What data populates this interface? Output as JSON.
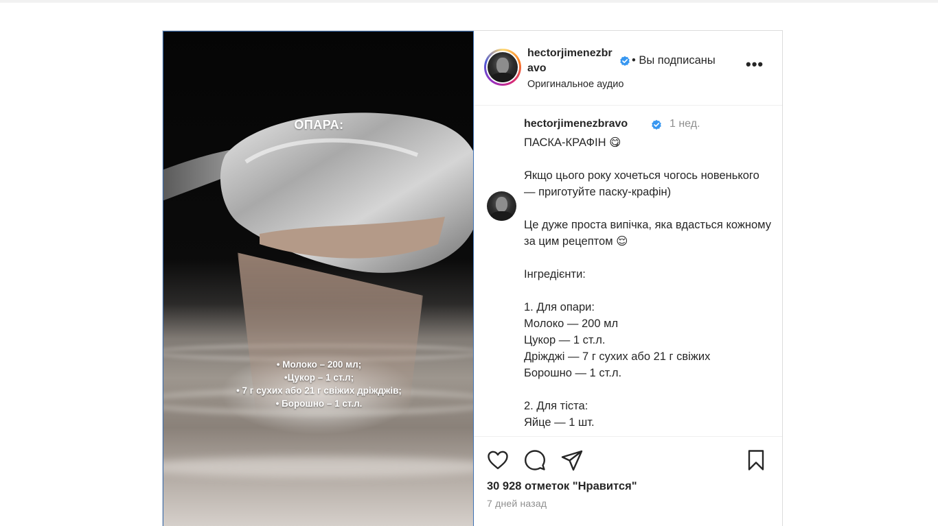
{
  "post": {
    "media": {
      "overlay_title": "ОПАРА:",
      "overlay_lines": [
        "• Молоко – 200 мл;",
        "•Цукор – 1 ст.л;",
        "• 7 г сухих або 21 г свіжих дріжджів;",
        "• Борошно – 1 ст.л."
      ]
    },
    "header": {
      "username": "hectorjimenezbravo",
      "follow_status": "• Вы подписаны",
      "audio_label": "Оригинальное аудио",
      "more_label": "•••",
      "verified_icon": "verified-badge-icon",
      "verified_color": "#3897f0"
    },
    "caption": {
      "username": "hectorjimenezbravo",
      "time_ago": "1 нед.",
      "text": "ПАСКА-КРАФІН 😋\n\nЯкщо цього року хочеться чогось новенького — приготуйте паску-крафін)\n\nЦе дуже проста випічка, яка вдасться кожному за цим рецептом 😌\n\nІнгредієнти:\n\n1. Для опари:\nМолоко — 200 мл\nЦукор — 1 ст.л.\nДріжджі — 7 г сухих або 21 г свіжих\nБорошно — 1 ст.л.\n\n2. Для тіста:\nЯйце — 1 шт."
    },
    "actions": {
      "icons": [
        "heart-icon",
        "comment-icon",
        "share-icon",
        "bookmark-icon"
      ],
      "likes_text": "30 928 отметок \"Нравится\"",
      "posted_ago": "7 дней назад"
    }
  }
}
